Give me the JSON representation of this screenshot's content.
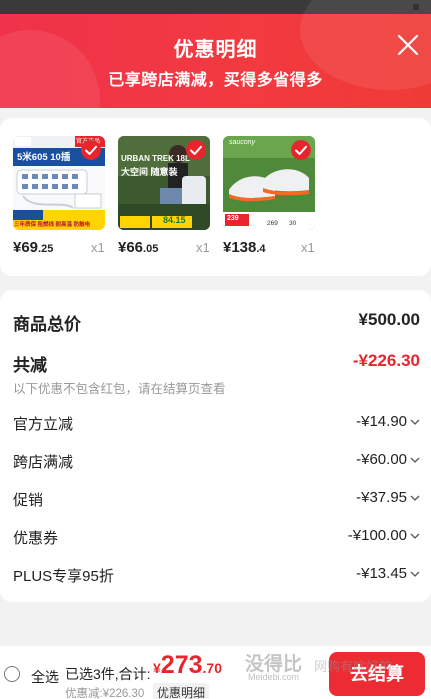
{
  "header": {
    "title": "优惠明细",
    "subtitle": "已享跨店满减，买得多省得多"
  },
  "products": [
    {
      "image_text_top": "5米605 10插",
      "image_badge": "官方正品",
      "image_caption": "三年质保 阻燃线 耐高温 防触电",
      "price_int": "¥69",
      "price_dec": ".25",
      "qty": "x1"
    },
    {
      "image_text_top": "URBAN TREK 18L",
      "image_caption": "大空间 随意装",
      "image_price": "84.15",
      "price_int": "¥66",
      "price_dec": ".05",
      "qty": "x1"
    },
    {
      "image_brand": "saucony",
      "image_prices": [
        "239",
        "269",
        "30"
      ],
      "price_int": "¥138",
      "price_dec": ".4",
      "qty": "x1"
    }
  ],
  "summary": {
    "goods_total_label": "商品总价",
    "goods_total_value": "¥500.00",
    "total_discount_label": "共减",
    "total_discount_value": "-¥226.30",
    "note": "以下优惠不包含红包，请在结算页查看",
    "items": [
      {
        "label": "官方立减",
        "value": "-¥14.90"
      },
      {
        "label": "跨店满减",
        "value": "-¥60.00"
      },
      {
        "label": "促销",
        "value": "-¥37.95"
      },
      {
        "label": "优惠券",
        "value": "-¥100.00"
      },
      {
        "label": "PLUS专享95折",
        "value": "-¥13.45"
      }
    ]
  },
  "bottom": {
    "select_all": "全选",
    "selected": "已选3件,合计:",
    "total_yen": "¥",
    "total_int": "273",
    "total_dec": ".70",
    "saved": "优惠减:¥226.30",
    "detail_button": "优惠明细",
    "checkout": "去结算"
  },
  "watermark": {
    "text": "没得比",
    "sub": "Meidebi.com",
    "extra": "网购有啥好的"
  },
  "colors": {
    "accent": "#e8252c",
    "header_bg": "#f0324a"
  }
}
